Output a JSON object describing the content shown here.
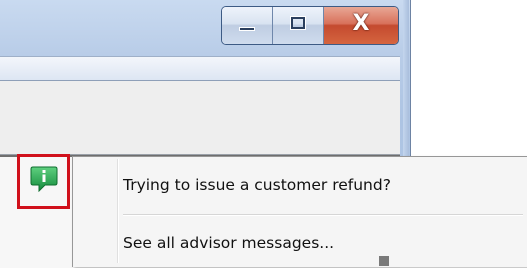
{
  "window": {
    "caption_buttons": {
      "minimize_icon": "minimize-icon",
      "maximize_icon": "maximize-icon",
      "close_glyph": "X",
      "close_color": "#c44a2f"
    }
  },
  "advisor": {
    "icon": "info-speech-bubble-icon",
    "icon_color": "#1e9a4a",
    "highlight_color": "#d0101b"
  },
  "popup_menu": {
    "items": [
      {
        "label": "Trying to issue a customer refund?"
      },
      {
        "label": "See all advisor messages..."
      }
    ]
  }
}
